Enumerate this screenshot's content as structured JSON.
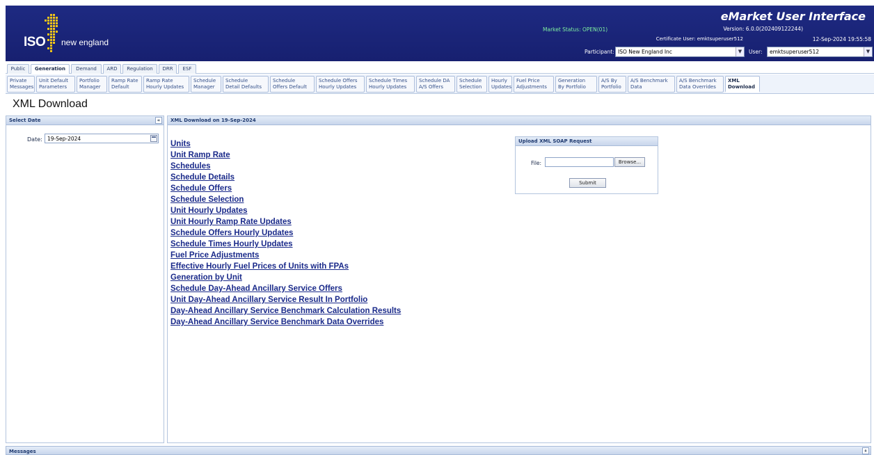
{
  "header": {
    "logo_iso": "ISO",
    "logo_ne": "new england",
    "app_title": "eMarket User Interface",
    "version": "Version: 6.0.0(202409122244)",
    "market_status": "Market Status: OPEN(01)",
    "certificate_user": "Certificate User: emktsuperuser512",
    "datetime": "12-Sep-2024 19:55:58",
    "participant_label": "Participant:",
    "participant_value": "ISO New England Inc",
    "user_label": "User:",
    "user_value": "emktsuperuser512"
  },
  "tabs_main": [
    "Public",
    "Generation",
    "Demand",
    "ARD",
    "Regulation",
    "DRR",
    "ESF"
  ],
  "tabs_main_active": "Generation",
  "tabs_sub": [
    "Private\nMessages",
    "Unit Default\nParameters",
    "Portfolio\nManager",
    "Ramp Rate\nDefault",
    "Ramp Rate\nHourly Updates",
    "Schedule\nManager",
    "Schedule\nDetail Defaults",
    "Schedule\nOffers Default",
    "Schedule Offers\nHourly Updates",
    "Schedule Times\nHourly Updates",
    "Schedule DA\nA/S Offers",
    "Schedule\nSelection",
    "Hourly\nUpdates",
    "Fuel Price\nAdjustments",
    "Generation\nBy Portfolio",
    "A/S By\nPortfolio",
    "A/S Benchmark\nData",
    "A/S Benchmark\nData Overrides",
    "XML\nDownload"
  ],
  "page_title": "XML Download",
  "left_panel": {
    "title": "Select Date",
    "collapse": "«",
    "date_label": "Date:",
    "date_value": "19-Sep-2024"
  },
  "main_panel": {
    "title": "XML Download on 19-Sep-2024",
    "links": [
      "Units",
      "Unit Ramp Rate",
      "Schedules",
      "Schedule Details",
      "Schedule Offers",
      "Schedule Selection",
      "Unit Hourly Updates",
      "Unit Hourly Ramp Rate Updates",
      "Schedule Offers Hourly Updates",
      "Schedule Times Hourly Updates",
      "Fuel Price Adjustments",
      "Effective Hourly Fuel Prices of Units with FPAs",
      "Generation by Unit",
      "Schedule Day-Ahead Ancillary Service Offers",
      "Unit Day-Ahead Ancillary Service Result In Portfolio",
      "Day-Ahead Ancillary Service Benchmark Calculation Results",
      "Day-Ahead Ancillary Service Benchmark Data Overrides"
    ]
  },
  "upload": {
    "title": "Upload XML SOAP Request",
    "file_label": "File:",
    "browse_label": "Browse...",
    "submit_label": "Submit"
  },
  "messages": {
    "title": "Messages",
    "expand": "»"
  }
}
